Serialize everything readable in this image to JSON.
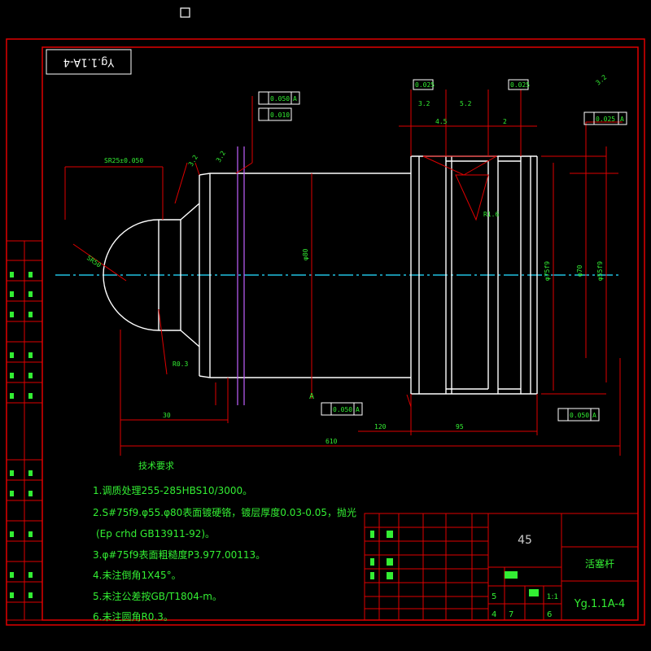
{
  "drawing": {
    "rotated_code": "Yg.1.1A-4",
    "material": "45",
    "part_name": "活塞杆",
    "drawing_number": "Yg.1.1A-4",
    "scale": "1:1",
    "title_cells": {
      "left_count": "5",
      "sheet_label": "4",
      "sheet_unit": "7",
      "sheet_total": "6"
    }
  },
  "tech_requirements": {
    "title": "技术要求",
    "lines": [
      "1.调质处理255-285HBS10/3000。",
      "2.S#75f9.φ55.φ80表面镀硬铬，镀层厚度0.03-0.05，抛光",
      "(Ep crhd   GB13911-92)。",
      "3.φ#75f9表面粗糙度P3.977.00113。",
      "4.未注倒角1X45°。",
      "5.未注公差按GB/T1804-m。",
      "6.未注圆角R0.3。"
    ]
  },
  "dimensions": {
    "sphere_dia": "SR25±0.050",
    "sphere_radius": "SR50",
    "overall_length": "610",
    "shoulder_len": "30",
    "step_dia": "φ80",
    "groove_len": "95",
    "right_len": "120",
    "chamfer": "R0.3",
    "end_chamfer": "R1.6",
    "groove_w1": "3.2",
    "groove_w2": "5.2",
    "groove_a": "4.5",
    "groove_b": "2",
    "roughness_val": "3.2",
    "dia_right1": "φ75f9",
    "dia_right2": "φ70",
    "dia_right3": "φ55f9"
  },
  "gdt": {
    "fcf1_val": "0.050",
    "fcf1_ref": "A",
    "fcf2_val": "0.010",
    "fcf3_val": "0.050",
    "fcf3_ref": "A",
    "fcf4_val": "0.050",
    "fcf4_ref": "A",
    "fcf5_val": "0.025",
    "fcf5_ref": "A",
    "top1_val": "0.025",
    "top2_val": "0.025",
    "datum": "A"
  },
  "colors": {
    "frame": "#e00000",
    "outline": "#ffffff",
    "dimension": "#e00000",
    "text": "#33ee33",
    "centerline": "#20c0e0",
    "section": "#c060ff"
  }
}
